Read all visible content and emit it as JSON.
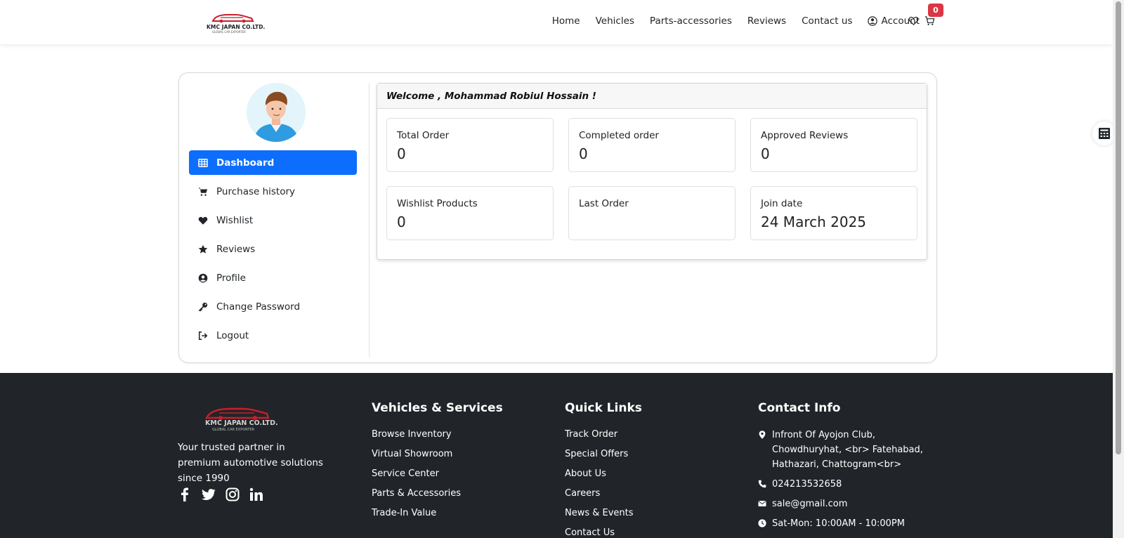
{
  "header": {
    "logo_text": "KMC JAPAN CO.LTD.",
    "logo_sub": "GLOBAL CAR EXPORTER",
    "nav": [
      {
        "label": "Home"
      },
      {
        "label": "Vehicles"
      },
      {
        "label": "Parts-accessories"
      },
      {
        "label": "Reviews"
      },
      {
        "label": "Contact us"
      }
    ],
    "account_label": "Account",
    "cart_count": "0",
    "accent_color": "#dc3545"
  },
  "sidebar": {
    "menu": [
      {
        "label": "Dashboard",
        "icon": "table-icon",
        "active": true
      },
      {
        "label": "Purchase history",
        "icon": "cart-icon"
      },
      {
        "label": "Wishlist",
        "icon": "heart-icon"
      },
      {
        "label": "Reviews",
        "icon": "star-icon"
      },
      {
        "label": "Profile",
        "icon": "user-circle-icon"
      },
      {
        "label": "Change Password",
        "icon": "key-icon"
      },
      {
        "label": "Logout",
        "icon": "logout-icon"
      }
    ],
    "active_color": "#0d6efd"
  },
  "dashboard": {
    "welcome": "Welcome , Mohammad Robiul Hossain !",
    "stats": [
      {
        "label": "Total Order",
        "value": "0"
      },
      {
        "label": "Completed order",
        "value": "0"
      },
      {
        "label": "Approved Reviews",
        "value": "0"
      },
      {
        "label": "Wishlist Products",
        "value": "0"
      },
      {
        "label": "Last Order",
        "value": ""
      },
      {
        "label": "Join date",
        "value": "24 March 2025"
      }
    ]
  },
  "footer": {
    "logo_text": "KMC JAPAN CO.LTD.",
    "logo_sub": "GLOBAL CAR EXPORTER",
    "tagline": "Your trusted partner in premium automotive solutions since 1990",
    "socials": [
      "facebook-icon",
      "twitter-icon",
      "instagram-icon",
      "linkedin-icon"
    ],
    "vehicles_title": "Vehicles & Services",
    "vehicles_links": [
      "Browse Inventory",
      "Virtual Showroom",
      "Service Center",
      "Parts & Accessories",
      "Trade-In Value"
    ],
    "quick_title": "Quick Links",
    "quick_links": [
      "Track Order",
      "Special Offers",
      "About Us",
      "Careers",
      "News & Events",
      "Contact Us"
    ],
    "contact_title": "Contact Info",
    "address": "Infront Of Ayojon Club, Chowdhuryhat, <br> Fatehabad, Hathazari, Chattogram<br>",
    "phone": "024213532658",
    "email": "sale@gmail.com",
    "hours": "Sat-Mon: 10:00AM - 10:00PM",
    "background": "#212529"
  }
}
